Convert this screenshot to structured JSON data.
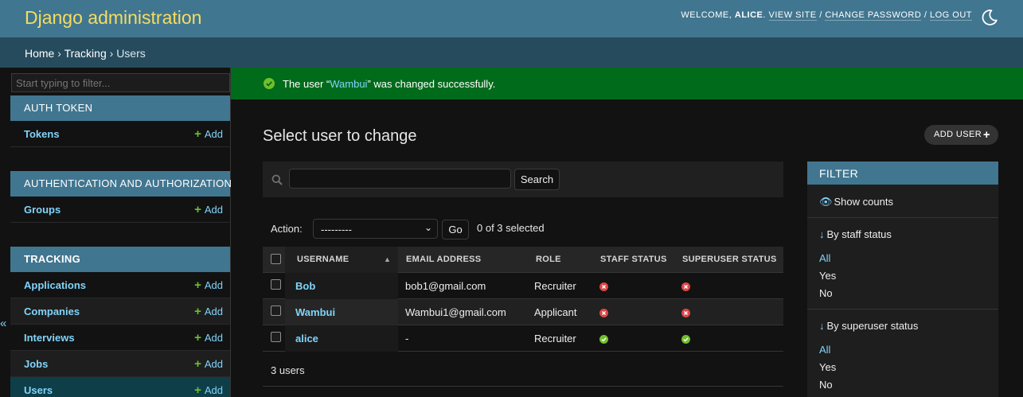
{
  "header": {
    "branding": "Django administration",
    "welcome": "Welcome,",
    "username": "alice",
    "view_site": "View site",
    "change_password": "Change password",
    "log_out": "Log out",
    "sep": "/"
  },
  "breadcrumbs": {
    "home": "Home",
    "app": "Tracking",
    "current": "Users",
    "sep": "›"
  },
  "sidebar": {
    "filter_placeholder": "Start typing to filter...",
    "add_label": "Add",
    "collapse_glyph": "«",
    "apps": [
      {
        "caption": "AUTH TOKEN",
        "models": [
          "Tokens"
        ]
      },
      {
        "caption": "AUTHENTICATION AND AUTHORIZATION",
        "models": [
          "Groups"
        ]
      },
      {
        "caption": "TRACKING",
        "models": [
          "Applications",
          "Companies",
          "Interviews",
          "Jobs",
          "Users"
        ]
      }
    ]
  },
  "message": {
    "prefix": "The user “",
    "object": "Wambui",
    "suffix": "” was changed successfully."
  },
  "main": {
    "title": "Select user to change",
    "add_button": "ADD USER",
    "search_button": "Search",
    "action_label": "Action:",
    "action_value": "---------",
    "go_button": "Go",
    "counter": "0 of 3 selected",
    "paginator": "3 users"
  },
  "table": {
    "columns": [
      "USERNAME",
      "EMAIL ADDRESS",
      "ROLE",
      "STAFF STATUS",
      "SUPERUSER STATUS"
    ],
    "rows": [
      {
        "username": "Bob",
        "email": "bob1@gmail.com",
        "role": "Recruiter",
        "staff": false,
        "superuser": false
      },
      {
        "username": "Wambui",
        "email": "Wambui1@gmail.com",
        "role": "Applicant",
        "staff": false,
        "superuser": false
      },
      {
        "username": "alice",
        "email": "-",
        "role": "Recruiter",
        "staff": true,
        "superuser": true
      }
    ]
  },
  "filter": {
    "caption": "FILTER",
    "show_counts": "Show counts",
    "groups": [
      {
        "title": "By staff status",
        "options": [
          "All",
          "Yes",
          "No"
        ]
      },
      {
        "title": "By superuser status",
        "options": [
          "All",
          "Yes",
          "No"
        ]
      }
    ]
  },
  "colors": {
    "header": "#417690",
    "breadcrumbs": "#264b5d",
    "branding": "#f5dd5d",
    "link": "#81d4fa",
    "success": "#006b1b",
    "icon_yes": "#70bf2b",
    "icon_no": "#dd4646"
  }
}
